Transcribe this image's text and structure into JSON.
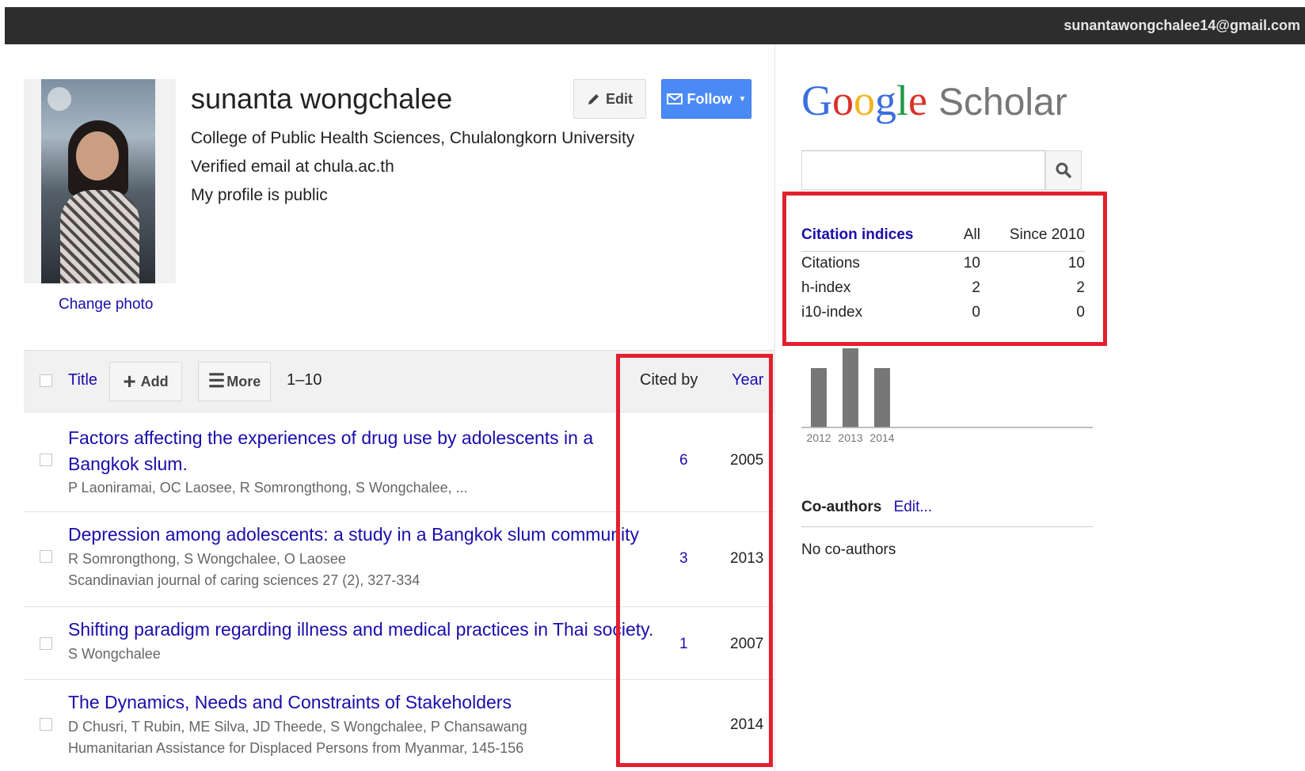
{
  "topbar": {
    "email": "sunantawongchalee14@gmail.com"
  },
  "profile": {
    "name": "sunanta wongchalee",
    "affiliation": "College of Public Health Sciences, Chulalongkorn University",
    "email_status": "Verified email at chula.ac.th",
    "visibility": "My profile is public",
    "change_photo": "Change photo",
    "edit_button": "Edit",
    "follow_button": "Follow"
  },
  "table": {
    "title_col": "Title",
    "add_button": "Add",
    "more_button": "More",
    "range": "1–10",
    "cited_by_col": "Cited by",
    "year_col": "Year"
  },
  "articles": [
    {
      "title_line1": "Factors affecting the experiences of drug use by adolescents in a",
      "title_line2": "Bangkok slum.",
      "authors": "P Laoniramai, OC Laosee, R Somrongthong, S Wongchalee, ...",
      "venue": "",
      "cited_by": "6",
      "year": "2005"
    },
    {
      "title_line1": "Depression among adolescents: a study in a Bangkok slum community",
      "title_line2": "",
      "authors": "R Somrongthong, S Wongchalee, O Laosee",
      "venue": "Scandinavian journal of caring sciences 27 (2), 327-334",
      "cited_by": "3",
      "year": "2013"
    },
    {
      "title_line1": "Shifting paradigm regarding illness and medical practices in Thai society.",
      "title_line2": "",
      "authors": "S Wongchalee",
      "venue": "",
      "cited_by": "1",
      "year": "2007"
    },
    {
      "title_line1": "The Dynamics, Needs and Constraints of Stakeholders",
      "title_line2": "",
      "authors": "D Chusri, T Rubin, ME Silva, JD Theede, S Wongchalee, P Chansawang",
      "venue": "Humanitarian Assistance for Displaced Persons from Myanmar, 145-156",
      "cited_by": "",
      "year": "2014"
    }
  ],
  "sidebar": {
    "logo_google": "Google",
    "logo_scholar": "Scholar",
    "search_value": "",
    "citation_indices": {
      "header": "Citation indices",
      "col_all": "All",
      "col_since": "Since 2010",
      "rows": [
        {
          "label": "Citations",
          "all": "10",
          "since": "10"
        },
        {
          "label": "h-index",
          "all": "2",
          "since": "2"
        },
        {
          "label": "i10-index",
          "all": "0",
          "since": "0"
        }
      ]
    },
    "coauthors": {
      "label": "Co-authors",
      "edit": "Edit...",
      "none": "No co-authors"
    }
  },
  "chart_data": {
    "type": "bar",
    "categories": [
      "2012",
      "2013",
      "2014"
    ],
    "values": [
      3,
      4,
      3
    ],
    "ylim": [
      0,
      4
    ]
  },
  "colors": {
    "link": "#1a0dab",
    "follow_button": "#4a8af4",
    "highlight_box": "#e3202d",
    "topbar": "#2d2d2d",
    "bar": "#777777"
  }
}
